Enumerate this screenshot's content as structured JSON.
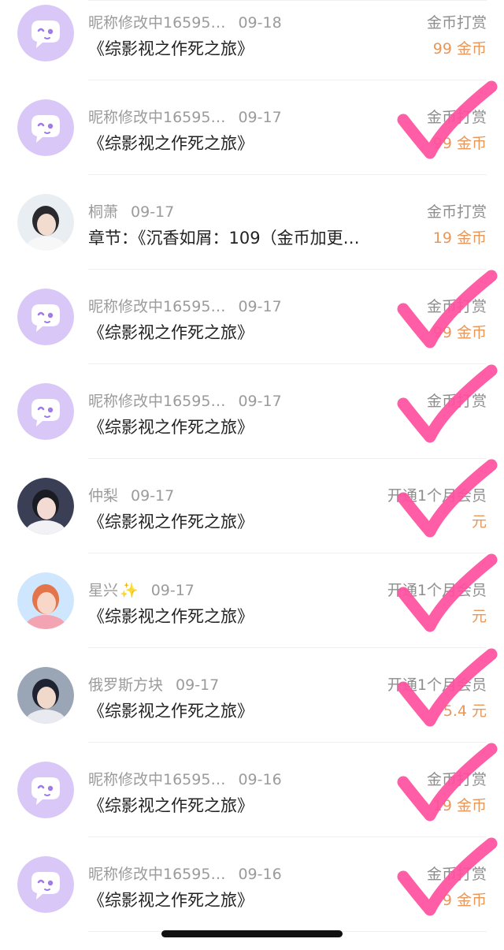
{
  "rewards": [
    {
      "user": "昵称修改中16595…",
      "date": "09-18",
      "title": "《综影视之作死之旅》",
      "type": "金币打赏",
      "amount": "99 金币",
      "avatar": "default-chat-avatar",
      "checked": false
    },
    {
      "user": "昵称修改中16595…",
      "date": "09-17",
      "title": "《综影视之作死之旅》",
      "type": "金币打赏",
      "amount": "99 金币",
      "avatar": "default-chat-avatar",
      "checked": true
    },
    {
      "user": "桐萧",
      "date": "09-17",
      "title": "章节：《沉香如屑：109（金币加更…",
      "type": "金币打赏",
      "amount": "19 金币",
      "avatar": "photo-avatar-man",
      "checked": false
    },
    {
      "user": "昵称修改中16595…",
      "date": "09-17",
      "title": "《综影视之作死之旅》",
      "type": "金币打赏",
      "amount": "99 金币",
      "avatar": "default-chat-avatar",
      "checked": true
    },
    {
      "user": "昵称修改中16595…",
      "date": "09-17",
      "title": "《综影视之作死之旅》",
      "type": "金币打赏",
      "amount": "",
      "avatar": "default-chat-avatar",
      "checked": true
    },
    {
      "user": "仲梨",
      "date": "09-17",
      "title": "《综影视之作死之旅》",
      "type": "开通1个月会员",
      "amount": "元",
      "avatar": "photo-avatar-girl",
      "checked": true
    },
    {
      "user": "星兴",
      "date": "09-17",
      "title": "《综影视之作死之旅》",
      "type": "开通1个月会员",
      "amount": "元",
      "avatar": "photo-avatar-woman",
      "checked": true,
      "sparkle": "✨"
    },
    {
      "user": "俄罗斯方块",
      "date": "09-17",
      "title": "《综影视之作死之旅》",
      "type": "开通1个月会员",
      "amount": "5.4 元",
      "avatar": "photo-avatar-boy",
      "checked": true
    },
    {
      "user": "昵称修改中16595…",
      "date": "09-16",
      "title": "《综影视之作死之旅》",
      "type": "金币打赏",
      "amount": "19 金币",
      "avatar": "default-chat-avatar",
      "checked": true
    },
    {
      "user": "昵称修改中16595…",
      "date": "09-16",
      "title": "《综影视之作死之旅》",
      "type": "金币打赏",
      "amount": "9 金币",
      "avatar": "default-chat-avatar",
      "checked": true
    }
  ],
  "colors": {
    "avatar_default_bg": "#d9c8f7",
    "avatar_default_bubble": "#ffffff",
    "avatar_default_accent": "#9f7be8",
    "amount_text": "#e8975a",
    "check_mark": "#ff4f9d"
  }
}
